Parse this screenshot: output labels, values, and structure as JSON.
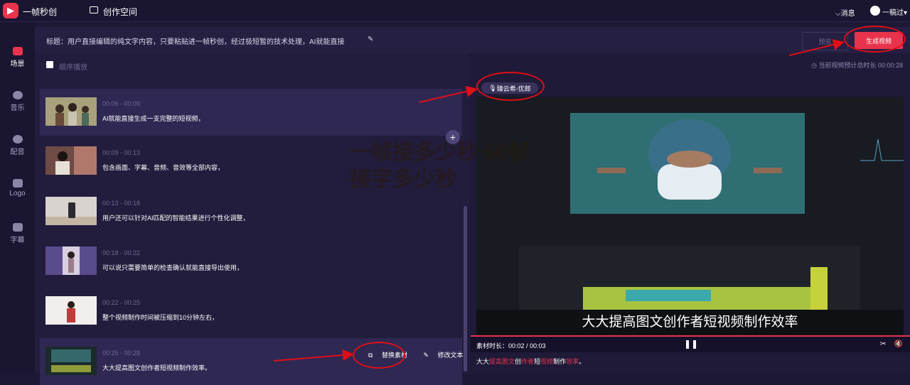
{
  "app": {
    "name": "一帧秒创",
    "logo_glyph": "▶",
    "workspace": "创作空间",
    "message": "消息",
    "user": "一稿过"
  },
  "sidebar": {
    "items": [
      {
        "label": "场景",
        "icon": "scene-icon",
        "active": true
      },
      {
        "label": "音乐",
        "icon": "music-icon"
      },
      {
        "label": "配音",
        "icon": "voice-icon"
      },
      {
        "label": "Logo",
        "icon": "logo-icon"
      },
      {
        "label": "字幕",
        "icon": "subtitle-icon"
      }
    ]
  },
  "header": {
    "title": "标题：用户直接编辑的纯文字内容，只要粘贴进一帧秒创，经过极短暂的技术处理，AI就能直接",
    "preview_label": "预览",
    "generate_label": "生成视频"
  },
  "list": {
    "sequential_label": "顺序播放"
  },
  "scenes": [
    {
      "time": "00:06 - 00:09",
      "text": "AI就能直接生成一支完整的短视频，",
      "active": true
    },
    {
      "time": "00:09 - 00:13",
      "text": "包含画面、字幕、音频、音效等全部内容，"
    },
    {
      "time": "00:13 - 00:18",
      "text": "用户还可以针对AI匹配的智能结果进行个性化调整，"
    },
    {
      "time": "00:18 - 00:22",
      "text": "可以说只需要简单的检查确认就能直接导出使用，"
    },
    {
      "time": "00:22 - 00:25",
      "text": "整个视频制作时间被压缩到10分钟左右，"
    },
    {
      "time": "00:25 - 00:28",
      "text": "大大提高图文创作者短视频制作效率。",
      "active": true
    }
  ],
  "scene_actions": {
    "replace": "替换素材",
    "edit": "修改文本",
    "add": "+"
  },
  "preview": {
    "total_time": "当前视频预计总时长 00:00:28",
    "voice": "臻云希-优郎",
    "subtitle": "大大提高图文创作者短视频制作效率",
    "duration": "素材时长：00:02 / 00:03",
    "subtitle_parts": [
      {
        "text": "大大",
        "hl": false
      },
      {
        "text": "提高图文",
        "hl": true
      },
      {
        "text": "创",
        "hl": false
      },
      {
        "text": "作者",
        "hl": true
      },
      {
        "text": "短",
        "hl": false
      },
      {
        "text": "视频",
        "hl": true
      },
      {
        "text": "制作",
        "hl": false
      },
      {
        "text": "效率",
        "hl": true
      },
      {
        "text": "。",
        "hl": false
      }
    ]
  },
  "watermark": [
    "一帧接多少秒 60帧",
    "接字多少秒"
  ],
  "colors": {
    "accent": "#e8334d",
    "annotation": "#e00e16"
  }
}
